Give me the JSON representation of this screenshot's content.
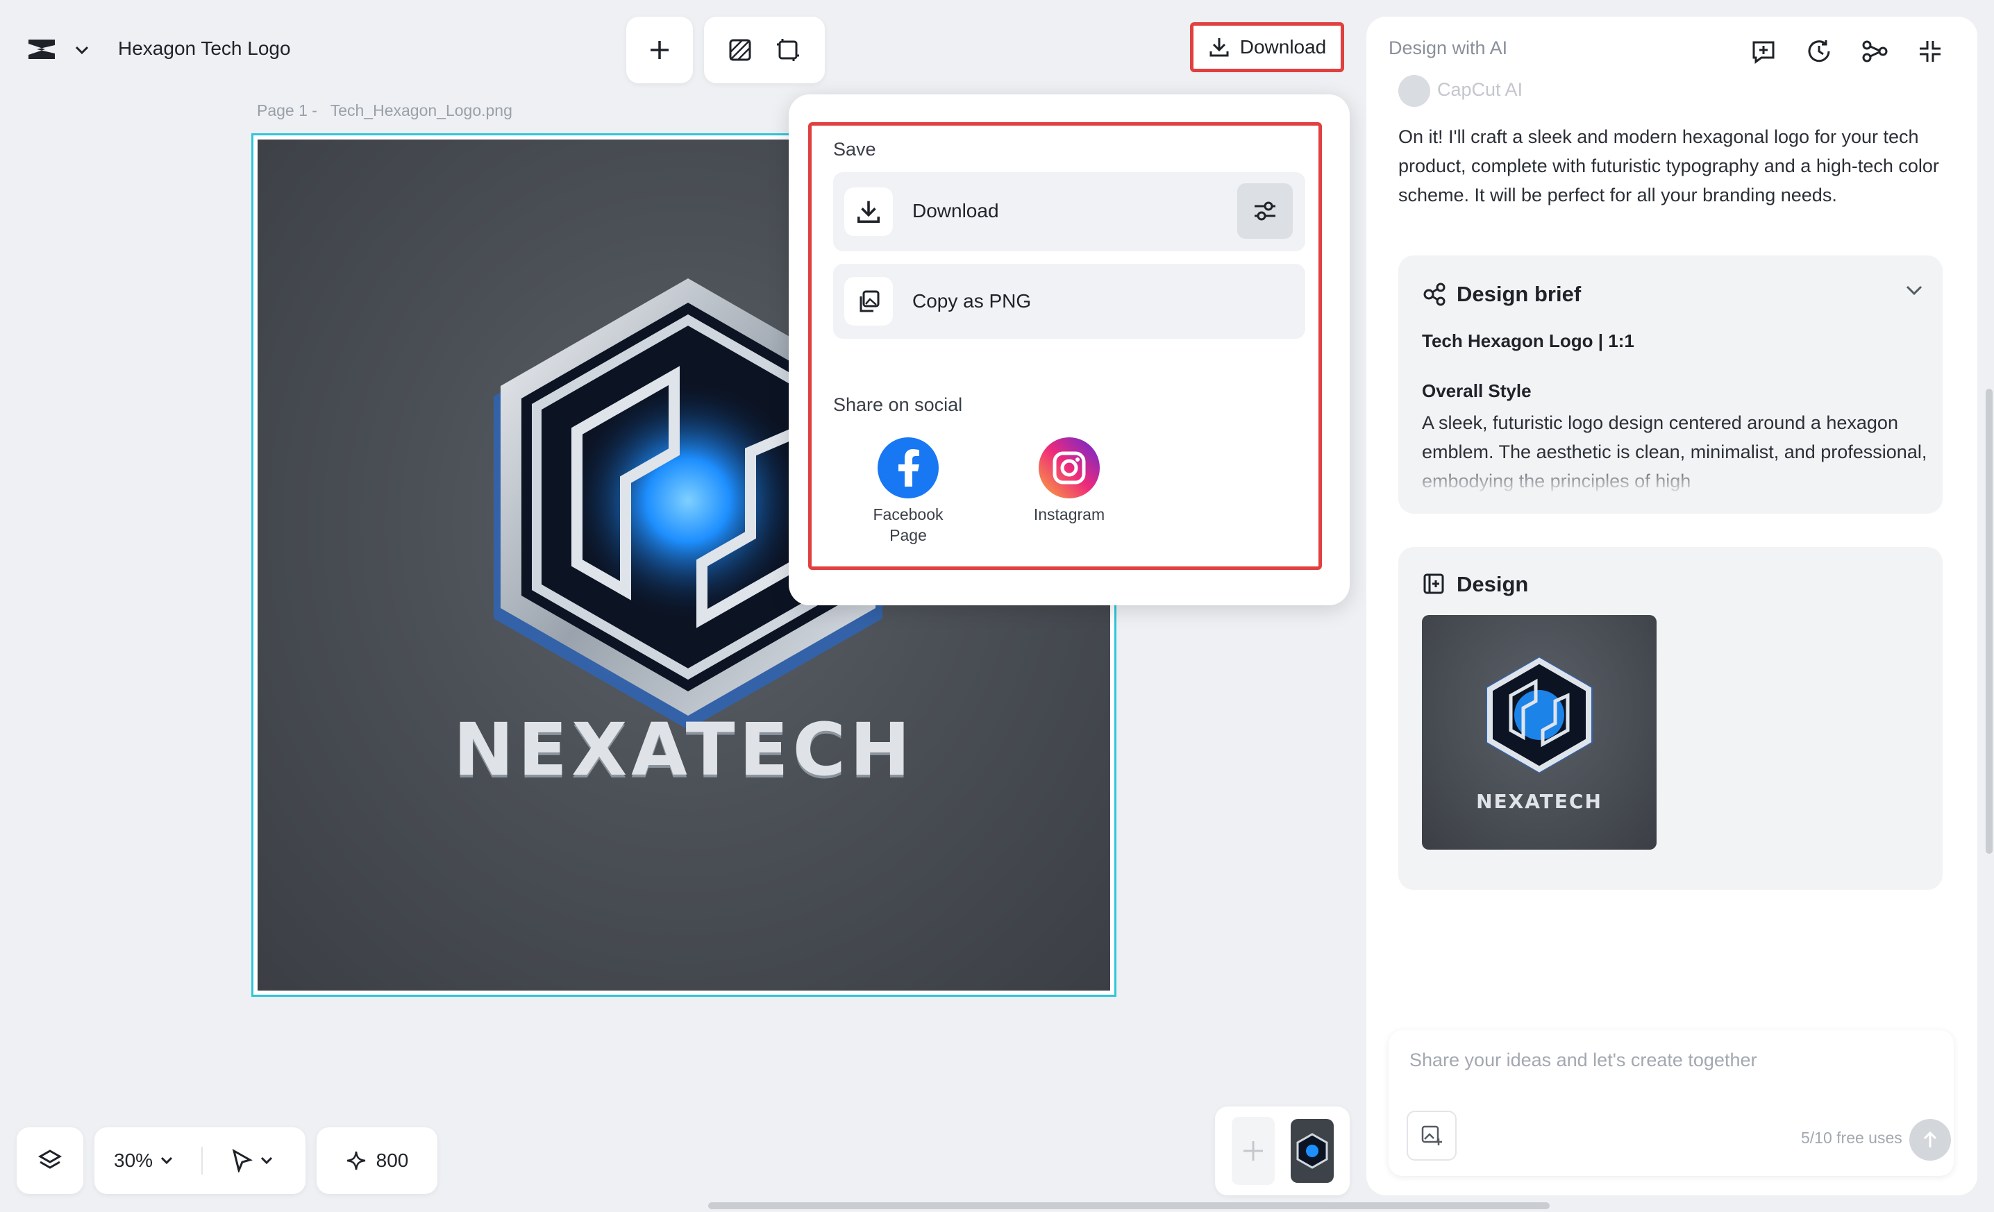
{
  "header": {
    "project_title": "Hexagon Tech Logo",
    "download_label": "Download"
  },
  "canvas": {
    "page_label": "Page 1 -",
    "file_name": "Tech_Hexagon_Logo.png",
    "logo_text": "NEXATECH"
  },
  "download_menu": {
    "save_heading": "Save",
    "download_label": "Download",
    "copy_label": "Copy as PNG",
    "share_heading": "Share on social",
    "social": [
      {
        "label": "Facebook Page"
      },
      {
        "label": "Instagram"
      }
    ]
  },
  "bottom_toolbar": {
    "zoom": "30%",
    "credits": "800"
  },
  "ai_panel": {
    "title": "Design with AI",
    "assistant_name": "CapCut AI",
    "message": "On it! I'll craft a sleek and modern hexagonal logo for your tech product, complete with futuristic typography and a high-tech color scheme. It will be perfect for all your branding needs.",
    "brief": {
      "heading": "Design brief",
      "subtitle": "Tech Hexagon Logo | 1:1",
      "style_heading": "Overall Style",
      "style_text": "A sleek, futuristic logo design centered around a hexagon emblem. The aesthetic is clean, minimalist, and professional, embodying the principles of high"
    },
    "design": {
      "heading": "Design",
      "thumb_text": "NEXATECH"
    },
    "input": {
      "placeholder": "Share your ideas and let's create together",
      "usage": "5/10 free uses"
    }
  },
  "colors": {
    "accent_highlight": "#e0403f",
    "frame_selection": "#2ec6d9",
    "logo_glow": "#1e8fff",
    "facebook": "#1877f2"
  }
}
